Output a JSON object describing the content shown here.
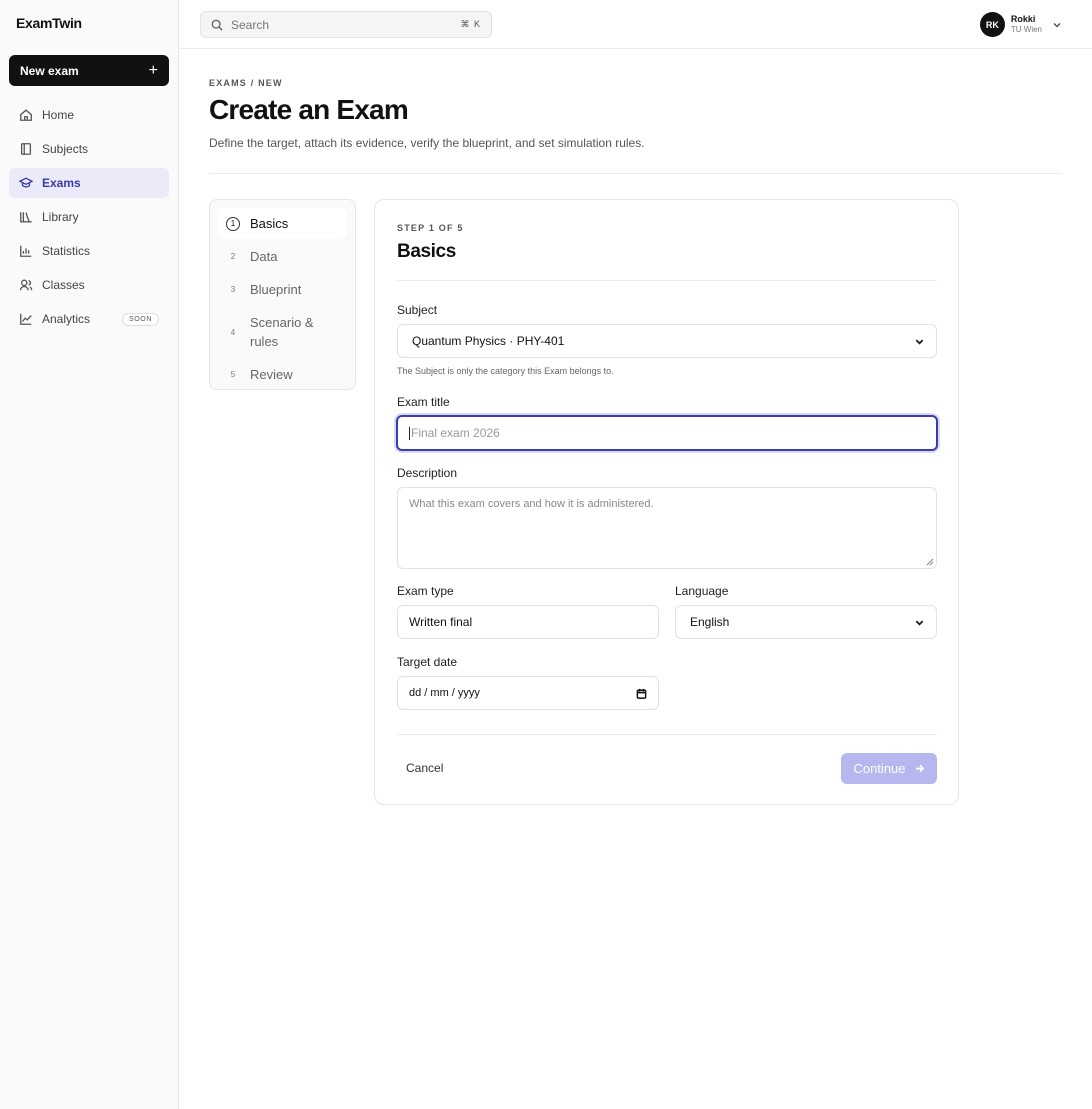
{
  "app": {
    "name": "ExamTwin"
  },
  "sidebar": {
    "new_exam_label": "New exam",
    "items": [
      {
        "label": "Home",
        "icon": "home-icon"
      },
      {
        "label": "Subjects",
        "icon": "book-icon"
      },
      {
        "label": "Exams",
        "icon": "graduation-cap-icon",
        "active": true
      },
      {
        "label": "Library",
        "icon": "library-icon"
      },
      {
        "label": "Statistics",
        "icon": "bar-chart-icon"
      },
      {
        "label": "Classes",
        "icon": "users-icon"
      },
      {
        "label": "Analytics",
        "icon": "trend-chart-icon",
        "badge": "SOON"
      }
    ]
  },
  "topbar": {
    "search_placeholder": "Search",
    "shortcut": "⌘ K",
    "user": {
      "initials": "RK",
      "name": "Rokki",
      "org": "TU Wien"
    }
  },
  "header": {
    "breadcrumb": "EXAMS / NEW",
    "title": "Create an Exam",
    "subtitle": "Define the target, attach its evidence, verify the blueprint, and set simulation rules."
  },
  "steps": [
    {
      "num": "1",
      "label": "Basics",
      "active": true
    },
    {
      "num": "2",
      "label": "Data"
    },
    {
      "num": "3",
      "label": "Blueprint"
    },
    {
      "num": "4",
      "label": "Scenario & rules"
    },
    {
      "num": "5",
      "label": "Review"
    }
  ],
  "form": {
    "step_of": "STEP 1 OF 5",
    "title": "Basics",
    "subject": {
      "label": "Subject",
      "value": "Quantum Physics · PHY-401",
      "hint": "The Subject is only the category this Exam belongs to."
    },
    "exam_title": {
      "label": "Exam title",
      "placeholder": "Final exam 2026"
    },
    "description": {
      "label": "Description",
      "placeholder": "What this exam covers and how it is administered."
    },
    "exam_type": {
      "label": "Exam type",
      "value": "Written final"
    },
    "language": {
      "label": "Language",
      "value": "English"
    },
    "target_date": {
      "label": "Target date",
      "placeholder": "dd / mm / yyyy"
    },
    "cancel_label": "Cancel",
    "continue_label": "Continue"
  },
  "colors": {
    "accent": "#3b3bb0",
    "active_nav_bg": "#eaeaf8",
    "continue_disabled": "#b7b7f0"
  }
}
